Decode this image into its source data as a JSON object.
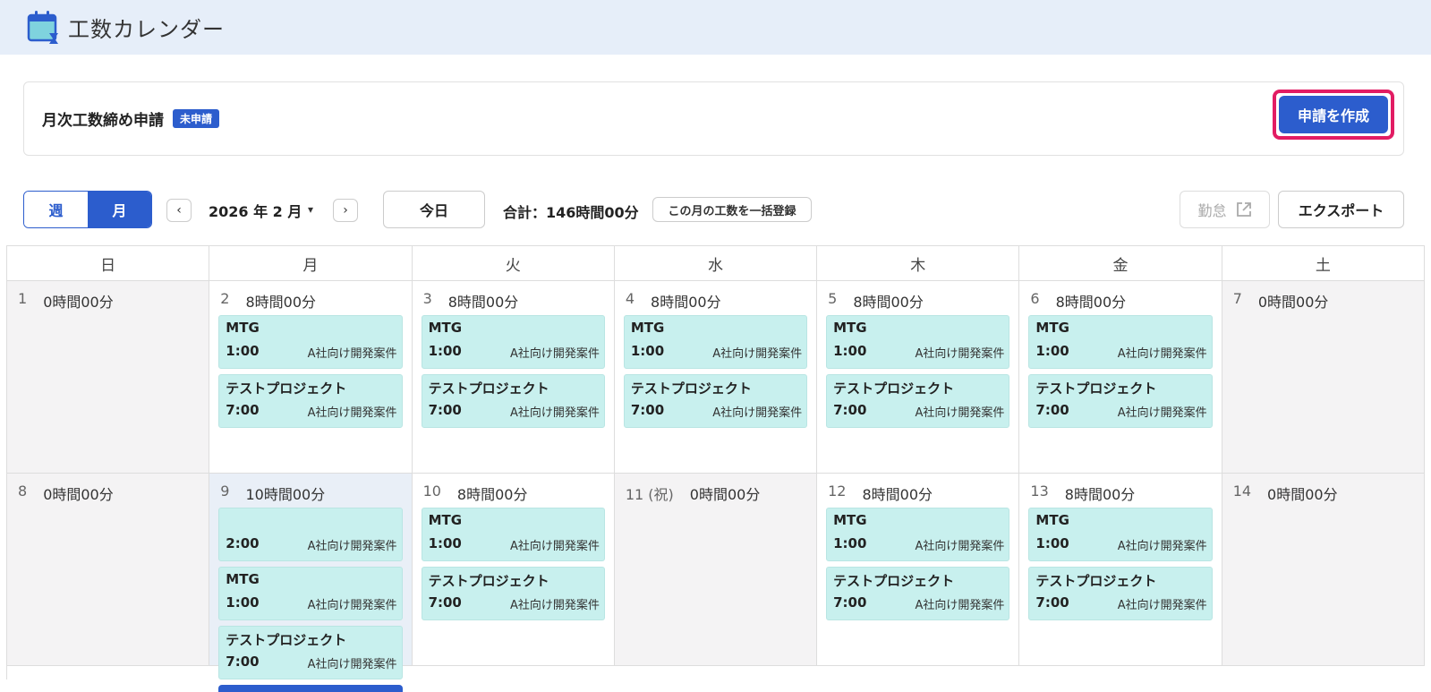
{
  "app": {
    "title": "工数カレンダー"
  },
  "closing": {
    "label": "月次工数締め申請",
    "status": "未申請",
    "create_button": "申請を作成"
  },
  "toolbar": {
    "week_label": "週",
    "month_label": "月",
    "prev_icon": "‹",
    "next_icon": "›",
    "current_month": "2026 年 2 月",
    "caret": "▾",
    "today": "今日",
    "total": "合計：146時間00分",
    "bulk_register": "この月の工数を一括登録",
    "attendance": "勤怠",
    "export": "エクスポート"
  },
  "weekdays": [
    "日",
    "月",
    "火",
    "水",
    "木",
    "金",
    "土"
  ],
  "weeks": [
    [
      {
        "num": "1",
        "hours": "0時間00分",
        "off": true,
        "events": []
      },
      {
        "num": "2",
        "hours": "8時間00分",
        "events": [
          {
            "name": "MTG",
            "time": "1:00",
            "project": "A社向け開発案件"
          },
          {
            "name": "テストプロジェクト",
            "time": "7:00",
            "project": "A社向け開発案件"
          }
        ]
      },
      {
        "num": "3",
        "hours": "8時間00分",
        "events": [
          {
            "name": "MTG",
            "time": "1:00",
            "project": "A社向け開発案件"
          },
          {
            "name": "テストプロジェクト",
            "time": "7:00",
            "project": "A社向け開発案件"
          }
        ]
      },
      {
        "num": "4",
        "hours": "8時間00分",
        "events": [
          {
            "name": "MTG",
            "time": "1:00",
            "project": "A社向け開発案件"
          },
          {
            "name": "テストプロジェクト",
            "time": "7:00",
            "project": "A社向け開発案件"
          }
        ]
      },
      {
        "num": "5",
        "hours": "8時間00分",
        "events": [
          {
            "name": "MTG",
            "time": "1:00",
            "project": "A社向け開発案件"
          },
          {
            "name": "テストプロジェクト",
            "time": "7:00",
            "project": "A社向け開発案件"
          }
        ]
      },
      {
        "num": "6",
        "hours": "8時間00分",
        "events": [
          {
            "name": "MTG",
            "time": "1:00",
            "project": "A社向け開発案件"
          },
          {
            "name": "テストプロジェクト",
            "time": "7:00",
            "project": "A社向け開発案件"
          }
        ]
      },
      {
        "num": "7",
        "hours": "0時間00分",
        "off": true,
        "events": []
      }
    ],
    [
      {
        "num": "8",
        "hours": "0時間00分",
        "off": true,
        "events": []
      },
      {
        "num": "9",
        "hours": "10時間00分",
        "today": true,
        "more": true,
        "events": [
          {
            "name": "",
            "time": "2:00",
            "project": "A社向け開発案件"
          },
          {
            "name": "MTG",
            "time": "1:00",
            "project": "A社向け開発案件"
          },
          {
            "name": "テストプロジェクト",
            "time": "7:00",
            "project": "A社向け開発案件"
          }
        ]
      },
      {
        "num": "10",
        "hours": "8時間00分",
        "events": [
          {
            "name": "MTG",
            "time": "1:00",
            "project": "A社向け開発案件"
          },
          {
            "name": "テストプロジェクト",
            "time": "7:00",
            "project": "A社向け開発案件"
          }
        ]
      },
      {
        "num": "11 (祝)",
        "hours": "0時間00分",
        "off": true,
        "events": []
      },
      {
        "num": "12",
        "hours": "8時間00分",
        "events": [
          {
            "name": "MTG",
            "time": "1:00",
            "project": "A社向け開発案件"
          },
          {
            "name": "テストプロジェクト",
            "time": "7:00",
            "project": "A社向け開発案件"
          }
        ]
      },
      {
        "num": "13",
        "hours": "8時間00分",
        "events": [
          {
            "name": "MTG",
            "time": "1:00",
            "project": "A社向け開発案件"
          },
          {
            "name": "テストプロジェクト",
            "time": "7:00",
            "project": "A社向け開発案件"
          }
        ]
      },
      {
        "num": "14",
        "hours": "0時間00分",
        "off": true,
        "events": []
      }
    ]
  ]
}
